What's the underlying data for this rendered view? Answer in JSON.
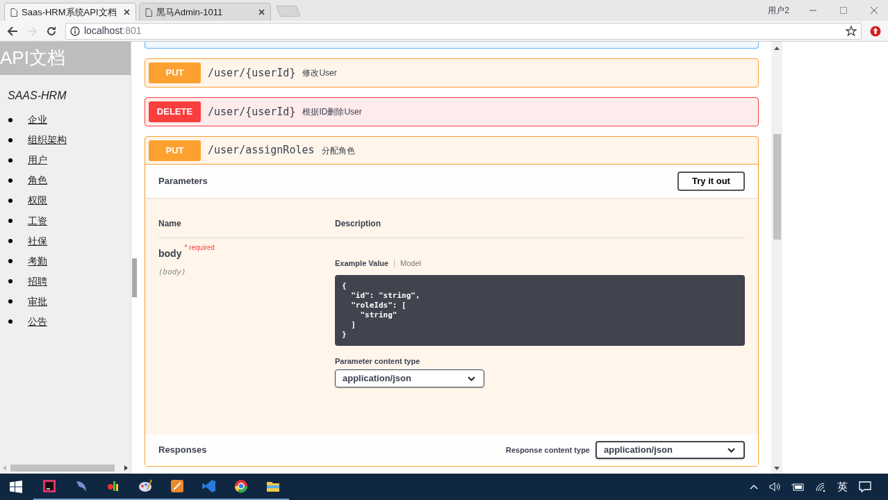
{
  "browser": {
    "tabs": [
      {
        "title": "Saas-HRM系统API文档",
        "selected": true
      },
      {
        "title": "黑马Admin-1011",
        "selected": false
      }
    ],
    "user_label": "用户2",
    "address": "localhost",
    "port": ":801"
  },
  "sidebar": {
    "title": "API文档",
    "subtitle": "SAAS-HRM",
    "links": [
      "企业",
      "组织架构",
      "用户",
      "角色",
      "权限",
      "工资",
      "社保",
      "考勤",
      "招聘",
      "审批",
      "公告"
    ]
  },
  "operations": [
    {
      "kind": "put",
      "method": "PUT",
      "path": "/user/{userId}",
      "summary": "修改User",
      "expanded": false
    },
    {
      "kind": "delete",
      "method": "DELETE",
      "path": "/user/{userId}",
      "summary": "根据ID删除User",
      "expanded": false
    },
    {
      "kind": "put",
      "method": "PUT",
      "path": "/user/assignRoles",
      "summary": "分配角色",
      "expanded": true
    }
  ],
  "details": {
    "parameters_title": "Parameters",
    "try_button": "Try it out",
    "columns": [
      "Name",
      "Description"
    ],
    "param": {
      "name": "body",
      "required_mark": "*",
      "required": "required",
      "type": "(body)"
    },
    "example_tabs": [
      {
        "label": "Example Value",
        "selected": true
      },
      {
        "label": "Model",
        "selected": false
      }
    ],
    "code": "{\n  \"id\": \"string\",\n  \"roleIds\": [\n    \"string\"\n  ]\n}",
    "content_type_label": "Parameter content type",
    "content_type_value": "application/json",
    "responses_title": "Responses",
    "response_type_label": "Response content type",
    "response_type_value": "application/json"
  },
  "taskbar": {
    "ime": "英"
  }
}
